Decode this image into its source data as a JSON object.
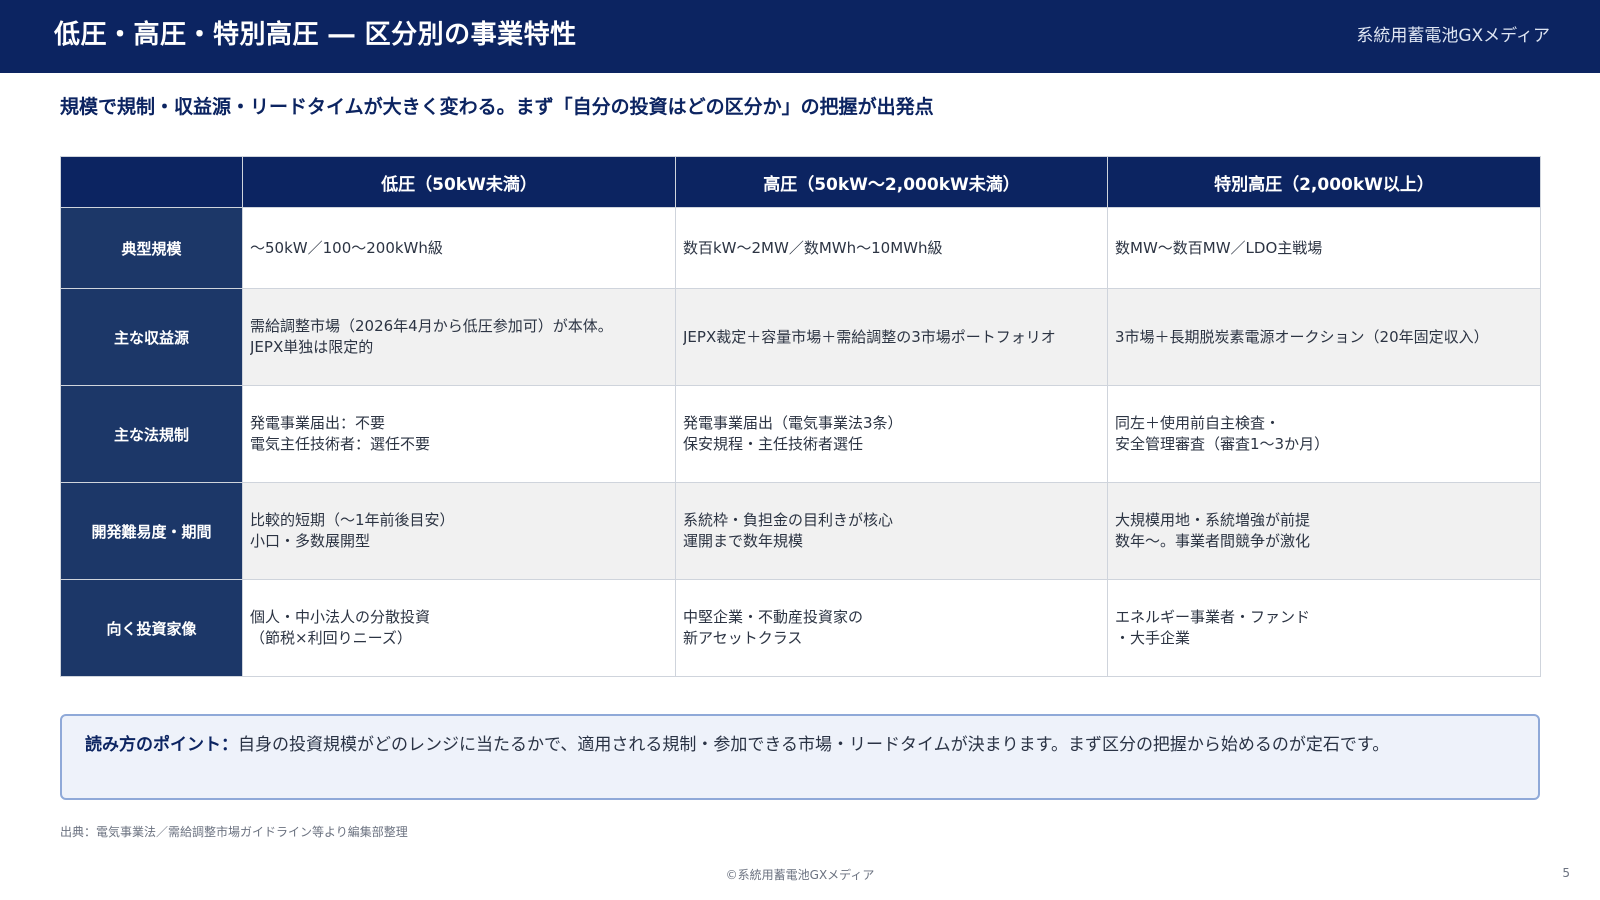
{
  "header": {
    "title": "低圧・高圧・特別高圧 ― 区分別の事業特性",
    "brand": "系統用蓄電池GXメディア"
  },
  "subtitle": "規模で規制・収益源・リードタイムが大きく変わる。まず「自分の投資はどの区分か」の把握が出発点",
  "table": {
    "columns": [
      "",
      "低圧（50kW未満）",
      "高圧（50kW〜2,000kW未満）",
      "特別高圧（2,000kW以上）"
    ],
    "rows": [
      {
        "label": "典型規模",
        "cells": [
          [
            "〜50kW／100〜200kWh級"
          ],
          [
            "数百kW〜2MW／数MWh〜10MWh級"
          ],
          [
            "数MW〜数百MW／LDO主戦場"
          ]
        ]
      },
      {
        "label": "主な収益源",
        "cells": [
          [
            "需給調整市場（2026年4月から低圧参加可）が本体。",
            "JEPX単独は限定的"
          ],
          [
            "JEPX裁定＋容量市場＋需給調整の3市場ポートフォリオ"
          ],
          [
            "3市場＋長期脱炭素電源オークション（20年固定収入）"
          ]
        ]
      },
      {
        "label": "主な法規制",
        "cells": [
          [
            "発電事業届出：不要",
            "電気主任技術者：選任不要"
          ],
          [
            "発電事業届出（電気事業法3条）",
            "保安規程・主任技術者選任"
          ],
          [
            "同左＋使用前自主検査・",
            "安全管理審査（審査1〜3か月）"
          ]
        ]
      },
      {
        "label": "開発難易度・期間",
        "cells": [
          [
            "比較的短期（〜1年前後目安）",
            "小口・多数展開型"
          ],
          [
            "系統枠・負担金の目利きが核心",
            "運開まで数年規模"
          ],
          [
            "大規模用地・系統増強が前提",
            "数年〜。事業者間競争が激化"
          ]
        ]
      },
      {
        "label": "向く投資家像",
        "cells": [
          [
            "個人・中小法人の分散投資",
            "（節税×利回りニーズ）"
          ],
          [
            "中堅企業・不動産投資家の",
            "新アセットクラス"
          ],
          [
            "エネルギー事業者・ファンド",
            "・大手企業"
          ]
        ]
      }
    ]
  },
  "note": {
    "label": "読み方のポイント：",
    "text": "自身の投資規模がどのレンジに当たるかで、適用される規制・参加できる市場・リードタイムが決まります。まず区分の把握から始めるのが定石です。"
  },
  "source": "出典：電気事業法／需給調整市場ガイドライン等より編集部整理",
  "footer": {
    "copyright": "©系統用蓄電池GXメディア",
    "page_number": "5"
  }
}
